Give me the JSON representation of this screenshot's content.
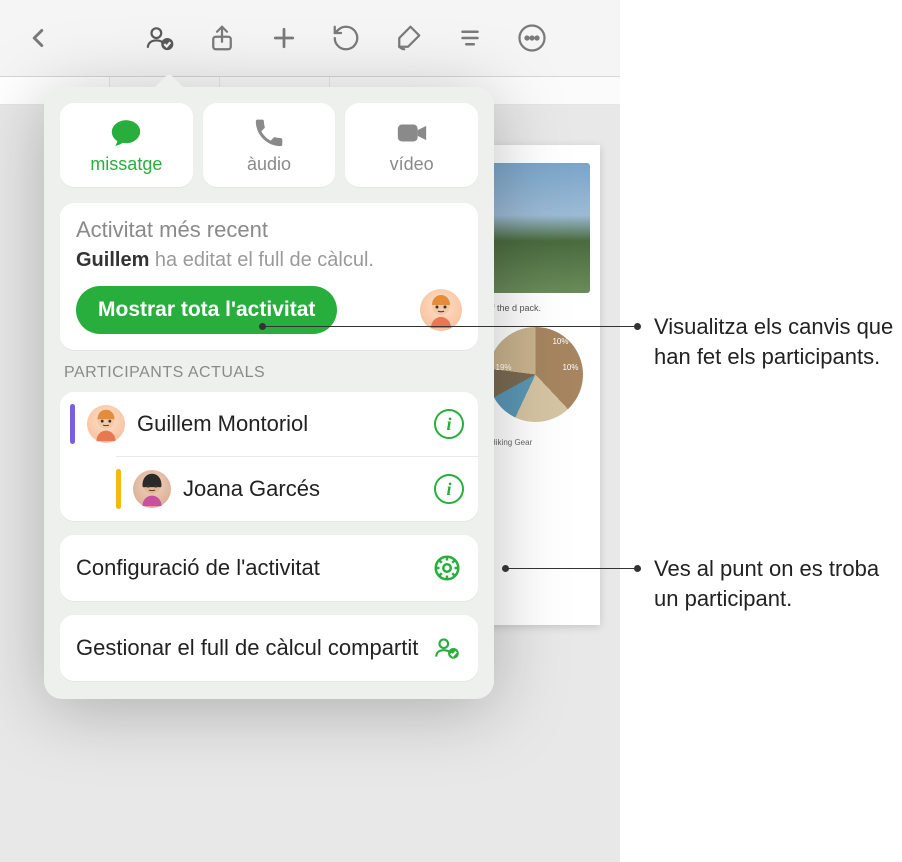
{
  "toolbar": {
    "icons": [
      "back",
      "collab",
      "share",
      "add",
      "undo",
      "format",
      "text-style",
      "more"
    ]
  },
  "popover": {
    "comm": {
      "message": "missatge",
      "audio": "àudio",
      "video": "vídeo"
    },
    "activity": {
      "title": "Activitat més recent",
      "actor": "Guillem",
      "action_suffix": " ha editat el full de càlcul.",
      "show_all": "Mostrar tota l'activitat"
    },
    "participants_label": "PARTICIPANTS ACTUALS",
    "participants": [
      {
        "name": "Guillem Montoriol",
        "color": "purple"
      },
      {
        "name": "Joana Garcés",
        "color": "yellow"
      }
    ],
    "settings_label": "Configuració de l'activitat",
    "manage_label": "Gestionar el full de càlcul compartit"
  },
  "callouts": {
    "changes": "Visualitza els canvis que han fet els participants.",
    "locate": "Ves al punt on es troba un participant."
  },
  "doc": {
    "text_snippet": "half the d pack.",
    "legend": "Hiking Gear"
  },
  "chart_data": {
    "type": "pie",
    "values": [
      19,
      10,
      10
    ],
    "visible_labels": [
      "19%",
      "10%",
      "10%"
    ]
  }
}
